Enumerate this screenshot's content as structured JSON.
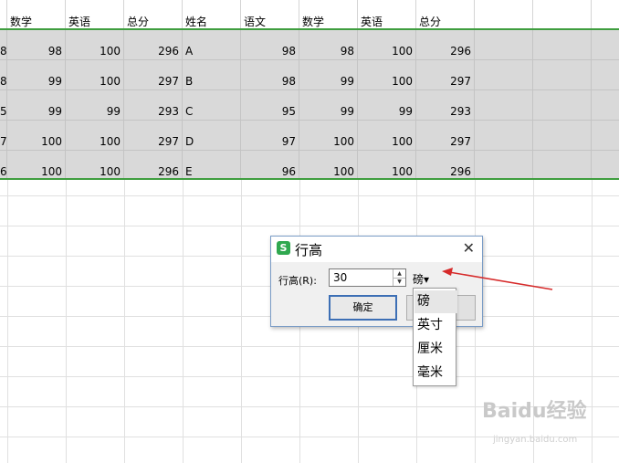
{
  "header": [
    "数学",
    "英语",
    "总分",
    "姓名",
    "语文",
    "数学",
    "英语",
    "总分"
  ],
  "rows": [
    {
      "c0": "8",
      "c1": "98",
      "c2": "100",
      "c3": "296",
      "name": "A",
      "c5": "98",
      "c6": "98",
      "c7": "100",
      "c8": "296"
    },
    {
      "c0": "8",
      "c1": "99",
      "c2": "100",
      "c3": "297",
      "name": "B",
      "c5": "98",
      "c6": "99",
      "c7": "100",
      "c8": "297"
    },
    {
      "c0": "5",
      "c1": "99",
      "c2": "99",
      "c3": "293",
      "name": "C",
      "c5": "95",
      "c6": "99",
      "c7": "99",
      "c8": "293"
    },
    {
      "c0": "7",
      "c1": "100",
      "c2": "100",
      "c3": "297",
      "name": "D",
      "c5": "97",
      "c6": "100",
      "c7": "100",
      "c8": "297"
    },
    {
      "c0": "6",
      "c1": "100",
      "c2": "100",
      "c3": "296",
      "name": "E",
      "c5": "96",
      "c6": "100",
      "c7": "100",
      "c8": "296"
    }
  ],
  "dialog": {
    "title": "行高",
    "logo": "S",
    "field_label": "行高(R):",
    "value": "30",
    "unit": "磅▾",
    "ok_label": "确定",
    "close": "✕"
  },
  "dropdown": [
    "磅",
    "英寸",
    "厘米",
    "毫米"
  ],
  "watermark": "Baidu经验",
  "watermark_sub": "jingyan.baidu.com",
  "colors": {
    "selection": "#d9d9d9",
    "selection_border": "#3f9e3f",
    "arrow": "#d62a2a"
  }
}
